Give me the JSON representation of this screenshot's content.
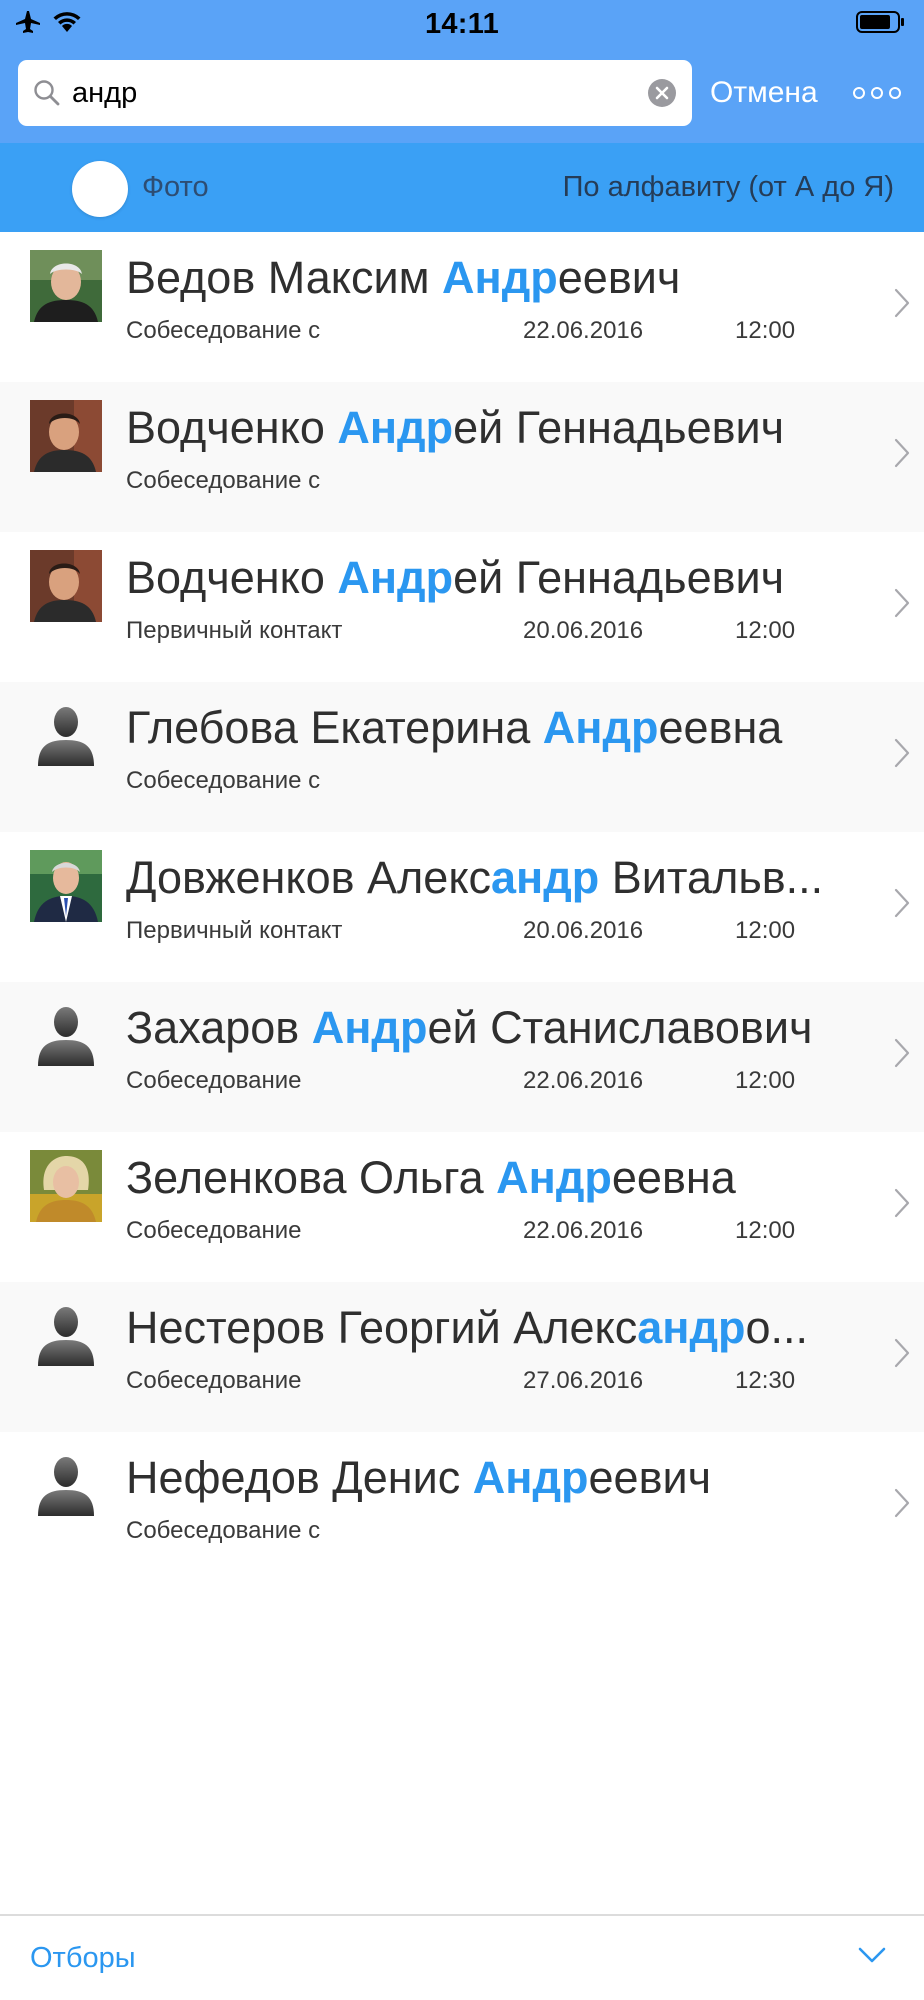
{
  "status_bar": {
    "time": "14:11"
  },
  "search": {
    "query": "андр",
    "cancel_label": "Отмена"
  },
  "filter_bar": {
    "photo_label": "Фото",
    "photo_toggle_on": false,
    "sort_label": "По алфавиту (от А до Я)"
  },
  "highlight_color": "#2b97f0",
  "accent_color": "#5aa3f7",
  "candidates": [
    {
      "name_parts": [
        {
          "t": "Ведов Максим ",
          "h": false
        },
        {
          "t": "Андр",
          "h": true
        },
        {
          "t": "еевич",
          "h": false
        }
      ],
      "status": "Собеседование с",
      "date": "22.06.2016",
      "time": "12:00",
      "avatar": "photo-older-man"
    },
    {
      "name_parts": [
        {
          "t": "Водченко ",
          "h": false
        },
        {
          "t": "Андр",
          "h": true
        },
        {
          "t": "ей Геннадьевич",
          "h": false
        }
      ],
      "status": "Собеседование с",
      "date": "",
      "time": "",
      "avatar": "photo-young-man"
    },
    {
      "name_parts": [
        {
          "t": "Водченко ",
          "h": false
        },
        {
          "t": "Андр",
          "h": true
        },
        {
          "t": "ей Геннадьевич",
          "h": false
        }
      ],
      "status": "Первичный контакт",
      "date": "20.06.2016",
      "time": "12:00",
      "avatar": "photo-young-man"
    },
    {
      "name_parts": [
        {
          "t": "Глебова Екатерина ",
          "h": false
        },
        {
          "t": "Андр",
          "h": true
        },
        {
          "t": "еевна",
          "h": false
        }
      ],
      "status": "Собеседование с",
      "date": "",
      "time": "",
      "avatar": "placeholder-person"
    },
    {
      "name_parts": [
        {
          "t": "Довженков Алекс",
          "h": false
        },
        {
          "t": "андр",
          "h": true
        },
        {
          "t": " Витальв...",
          "h": false
        }
      ],
      "status": "Первичный контакт",
      "date": "20.06.2016",
      "time": "12:00",
      "avatar": "photo-man-suit"
    },
    {
      "name_parts": [
        {
          "t": "Захаров ",
          "h": false
        },
        {
          "t": "Андр",
          "h": true
        },
        {
          "t": "ей Станиславович",
          "h": false
        }
      ],
      "status": "Собеседование",
      "date": "22.06.2016",
      "time": "12:00",
      "avatar": "placeholder-person"
    },
    {
      "name_parts": [
        {
          "t": "Зеленкова Ольга ",
          "h": false
        },
        {
          "t": "Андр",
          "h": true
        },
        {
          "t": "еевна",
          "h": false
        }
      ],
      "status": "Собеседование",
      "date": "22.06.2016",
      "time": "12:00",
      "avatar": "photo-woman"
    },
    {
      "name_parts": [
        {
          "t": "Нестеров Георгий Алекс",
          "h": false
        },
        {
          "t": "андр",
          "h": true
        },
        {
          "t": "о...",
          "h": false
        }
      ],
      "status": "Собеседование",
      "date": "27.06.2016",
      "time": "12:30",
      "avatar": "placeholder-person"
    },
    {
      "name_parts": [
        {
          "t": "Нефедов Денис ",
          "h": false
        },
        {
          "t": "Андр",
          "h": true
        },
        {
          "t": "еевич",
          "h": false
        }
      ],
      "status": "Собеседование с",
      "date": "",
      "time": "",
      "avatar": "placeholder-person"
    }
  ],
  "bottom_bar": {
    "filters_label": "Отборы"
  }
}
